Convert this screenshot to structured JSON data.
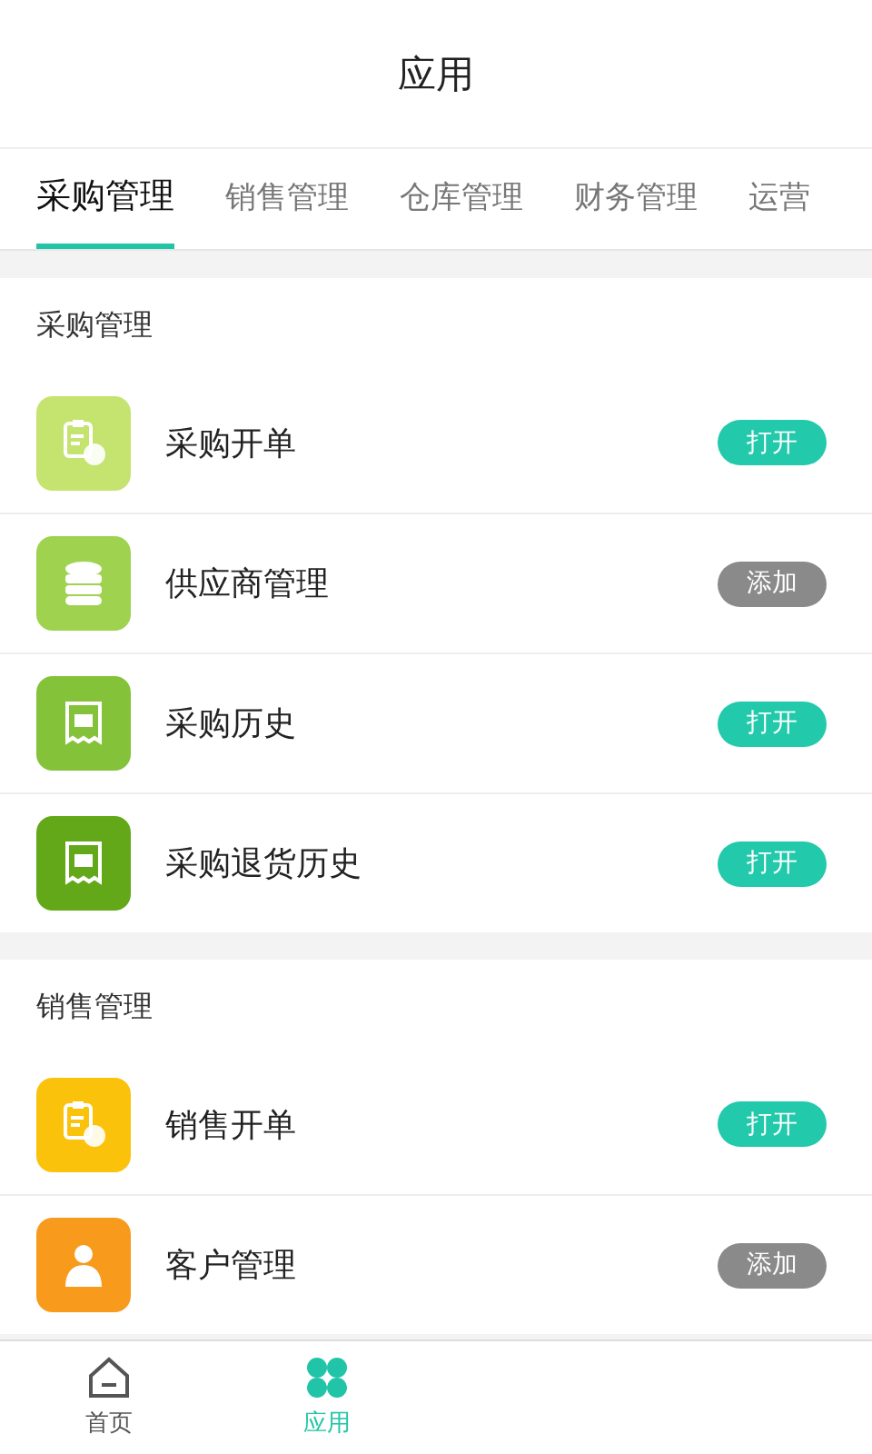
{
  "header": {
    "title": "应用"
  },
  "tabs": [
    {
      "label": "采购管理",
      "selected": true
    },
    {
      "label": "销售管理",
      "selected": false
    },
    {
      "label": "仓库管理",
      "selected": false
    },
    {
      "label": "财务管理",
      "selected": false
    },
    {
      "label": "运营",
      "selected": false
    }
  ],
  "sections": [
    {
      "title": "采购管理",
      "items": [
        {
          "name": "采购开单",
          "kind": "clipboard",
          "color": "#c5e36f",
          "action": {
            "kind": "open",
            "label": "打开"
          }
        },
        {
          "name": "供应商管理",
          "kind": "database",
          "color": "#9ed24f",
          "action": {
            "kind": "add",
            "label": "添加"
          }
        },
        {
          "name": "采购历史",
          "kind": "receipt",
          "color": "#84c23a",
          "action": {
            "kind": "open",
            "label": "打开"
          }
        },
        {
          "name": "采购退货历史",
          "kind": "receipt",
          "color": "#63a819",
          "action": {
            "kind": "open",
            "label": "打开"
          }
        }
      ]
    },
    {
      "title": "销售管理",
      "items": [
        {
          "name": "销售开单",
          "kind": "clipboard",
          "color": "#fbc20b",
          "action": {
            "kind": "open",
            "label": "打开"
          }
        },
        {
          "name": "客户管理",
          "kind": "person",
          "color": "#f89a1c",
          "action": {
            "kind": "add",
            "label": "添加"
          }
        }
      ]
    }
  ],
  "nav": [
    {
      "label": "首页",
      "kind": "home",
      "selected": false
    },
    {
      "label": "应用",
      "kind": "apps",
      "selected": true
    }
  ]
}
